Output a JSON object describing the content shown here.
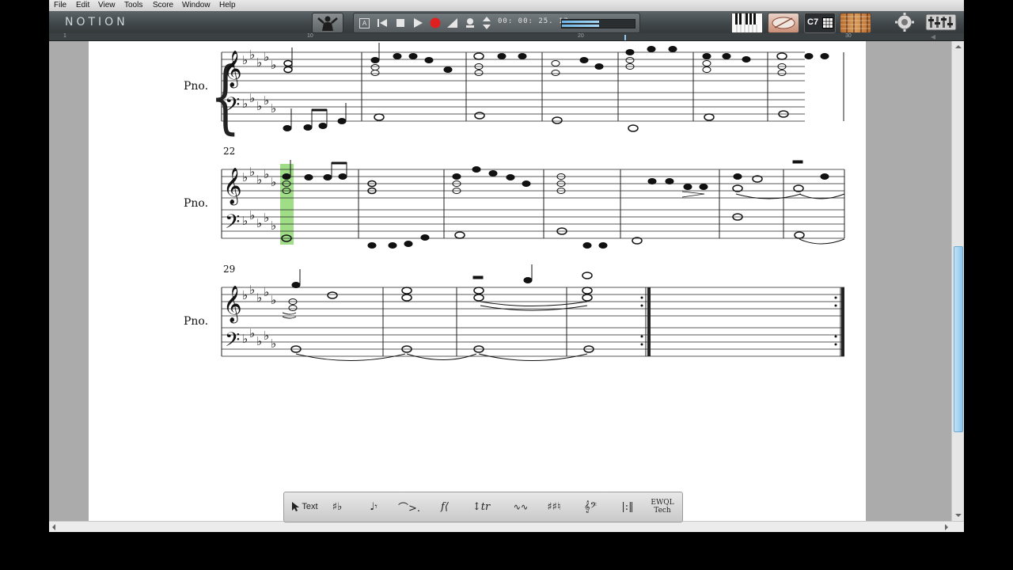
{
  "menu": [
    "File",
    "Edit",
    "View",
    "Tools",
    "Score",
    "Window",
    "Help"
  ],
  "app_title": "NOTION",
  "transport": {
    "timecode": "00: 00: 25. 13",
    "a_button": "A"
  },
  "ruler_marks": [
    "1",
    "10",
    "20",
    "30"
  ],
  "toolbar_right": {
    "c7_label": "C7"
  },
  "score": {
    "instrument_label": "Pno.",
    "measure_numbers": [
      "22",
      "29"
    ]
  },
  "palette": [
    {
      "name": "text-tool",
      "label": "Text"
    },
    {
      "name": "accidentals-tool",
      "label": "♯♭"
    },
    {
      "name": "notes-rests-tool",
      "label": "♩𝄾"
    },
    {
      "name": "articulations-tool",
      "label": "⌒>."
    },
    {
      "name": "dynamics-tool",
      "label": "f⟨"
    },
    {
      "name": "ornaments-tool",
      "label": "↕tr"
    },
    {
      "name": "guitar-effects-tool",
      "label": "∿∿"
    },
    {
      "name": "key-signature-tool",
      "label": "♯♯♮"
    },
    {
      "name": "clef-tool",
      "label": "𝄞𝄢"
    },
    {
      "name": "barline-tool",
      "label": "|:‖"
    },
    {
      "name": "ewql-tech-tool",
      "label": "EWQL Tech"
    }
  ],
  "colors": {
    "selection": "#7fd25f",
    "record": "#e02020",
    "toolbar": "#454b4e"
  }
}
